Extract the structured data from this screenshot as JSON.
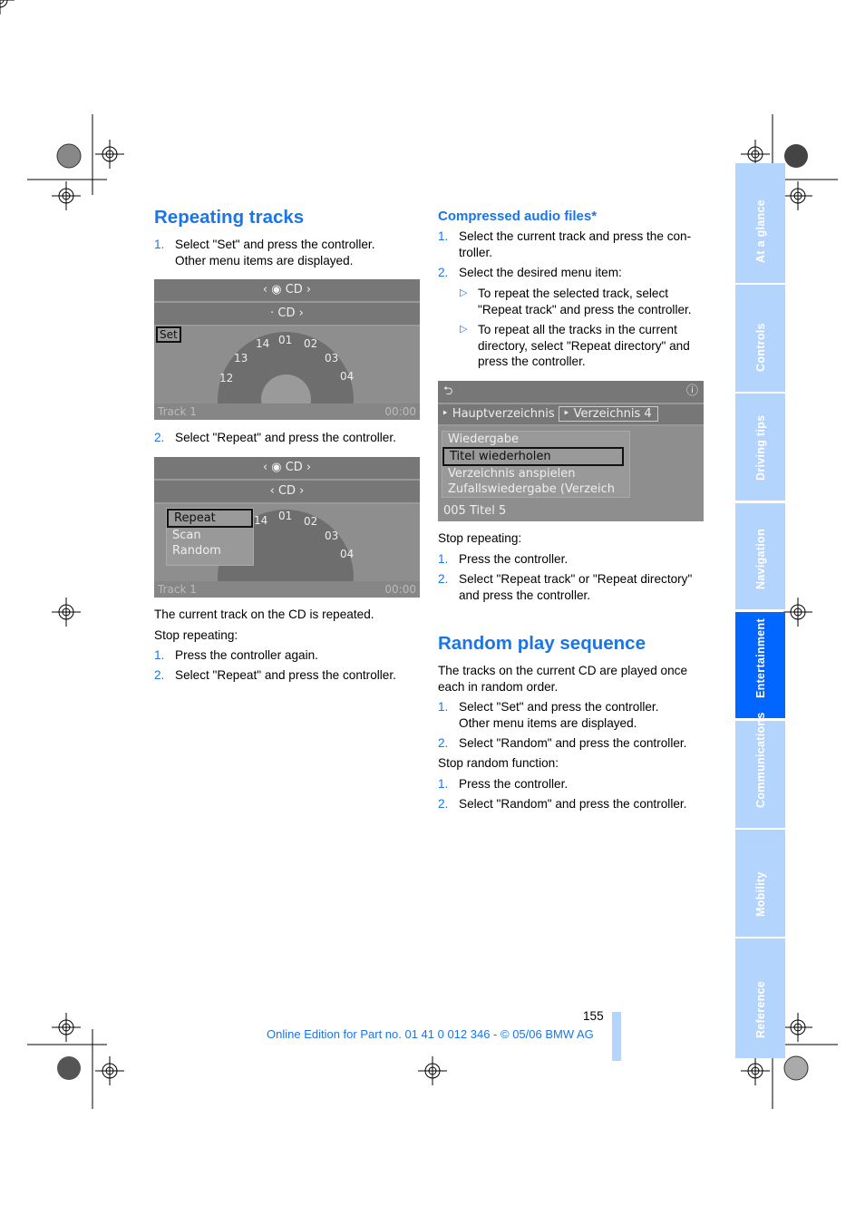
{
  "left": {
    "title": "Repeating tracks",
    "steps1": [
      {
        "n": "1.",
        "text": "Select \"Set\" and press the controller.",
        "text2": "Other menu items are displayed."
      },
      {
        "n": "2.",
        "text": "Select \"Repeat\" and press the controller."
      }
    ],
    "screen1": {
      "top": "CD",
      "sub": "CD",
      "set": "Set",
      "tracks": [
        "12",
        "13",
        "14",
        "01",
        "02",
        "03",
        "04"
      ],
      "track": "Track 1",
      "time": "00:00"
    },
    "screen2": {
      "top": "CD",
      "sub": "CD",
      "menu": [
        "Repeat",
        "Scan",
        "Random"
      ],
      "tracks": [
        "14",
        "01",
        "02",
        "03",
        "04"
      ],
      "track": "Track 1",
      "time": "00:00"
    },
    "result": "The current track on the CD is repeated.",
    "stop": "Stop repeating:",
    "steps2": [
      {
        "n": "1.",
        "text": "Press the controller again."
      },
      {
        "n": "2.",
        "text": "Select \"Repeat\" and press the controller."
      }
    ]
  },
  "right": {
    "title": "Compressed audio files*",
    "steps1": [
      {
        "n": "1.",
        "text": "Select the current track and press the con-",
        "text2": "troller."
      },
      {
        "n": "2.",
        "text": "Select the desired menu item:"
      }
    ],
    "subs": [
      {
        "l1": "To repeat the selected track, select",
        "l2": "\"Repeat track\" and press the controller."
      },
      {
        "l1": "To repeat all the tracks in the current",
        "l2": "directory, select \"Repeat directory\" and",
        "l3": "press the controller."
      }
    ],
    "screen": {
      "dir1": "Hauptverzeichnis",
      "dir2": "Verzeichnis 4",
      "menu": [
        "Wiedergabe",
        "Titel wiederholen",
        "Verzeichnis anspielen",
        "Zufallswiedergabe (Verzeich"
      ],
      "track": "005 Titel 5"
    },
    "stop": "Stop repeating:",
    "steps2": [
      {
        "n": "1.",
        "text": "Press the controller."
      },
      {
        "n": "2.",
        "text": "Select \"Repeat track\" or \"Repeat directory\"",
        "text2": "and press the controller."
      }
    ],
    "title2": "Random play sequence",
    "intro": "The tracks on the current CD are played once",
    "intro2": "each in random order.",
    "steps3": [
      {
        "n": "1.",
        "text": "Select \"Set\" and press the controller.",
        "text2": "Other menu items are displayed."
      },
      {
        "n": "2.",
        "text": "Select \"Random\" and press the controller."
      }
    ],
    "stop2": "Stop random function:",
    "steps4": [
      {
        "n": "1.",
        "text": "Press the controller."
      },
      {
        "n": "2.",
        "text": "Select \"Random\" and press the controller."
      }
    ]
  },
  "tabs": [
    {
      "label": "At a glance"
    },
    {
      "label": "Controls"
    },
    {
      "label": "Driving tips"
    },
    {
      "label": "Navigation"
    },
    {
      "label": "Entertainment",
      "active": true
    },
    {
      "label": "Communications"
    },
    {
      "label": "Mobility"
    },
    {
      "label": "Reference"
    }
  ],
  "footer": {
    "page": "155",
    "edition": "Online Edition for Part no. 01 41 0 012 346 - © 05/06 BMW AG"
  },
  "colors": {
    "accent": "#1a75e8",
    "tab": "#b3d4fc",
    "tab_active": "#0066ff"
  }
}
